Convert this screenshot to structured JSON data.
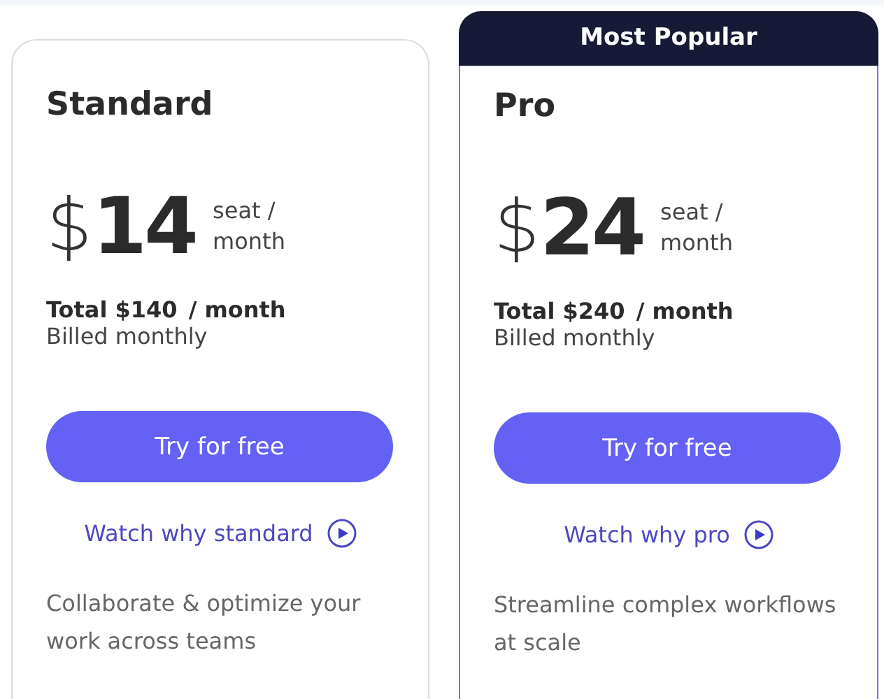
{
  "plans": [
    {
      "name": "Standard",
      "currency": "$",
      "price": "14",
      "unit": "seat /\nmonth",
      "total": "Total $140",
      "total_period": "/ month",
      "billing": "Billed monthly",
      "cta": "Try for free",
      "watch": "Watch why standard",
      "description": "Collaborate & optimize your work across teams"
    },
    {
      "name": "Pro",
      "badge": "Most Popular",
      "currency": "$",
      "price": "24",
      "unit": "seat /\nmonth",
      "total": "Total $240",
      "total_period": "/ month",
      "billing": "Billed monthly",
      "cta": "Try for free",
      "watch": "Watch why pro",
      "description": "Streamline complex workflows at scale"
    }
  ]
}
